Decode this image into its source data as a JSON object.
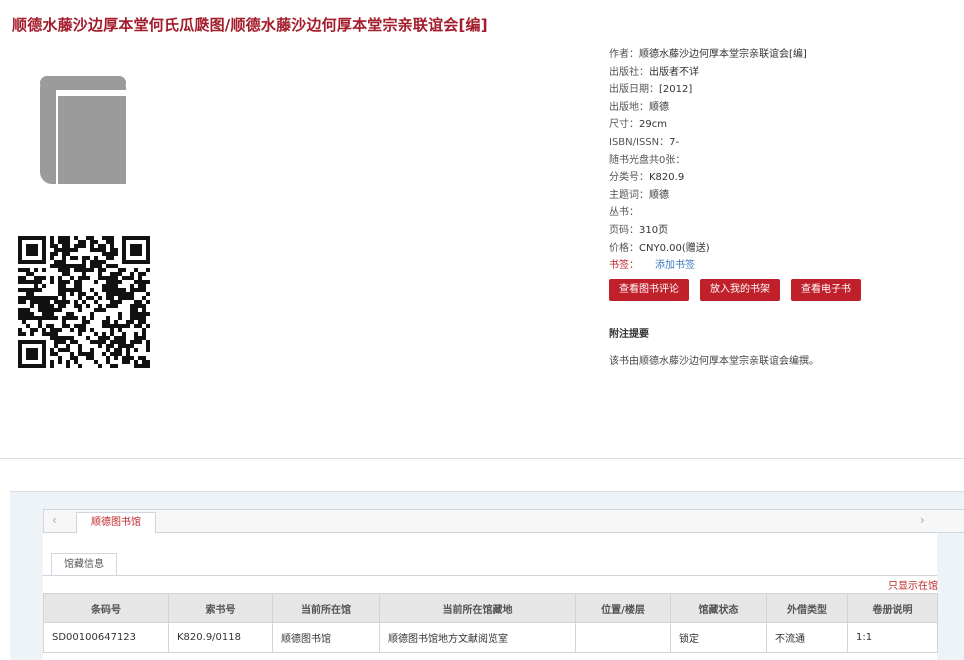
{
  "book": {
    "title": "顺德水藤沙边厚本堂何氏瓜瓞图/顺德水藤沙边何厚本堂宗亲联谊会[编]"
  },
  "metadata": [
    {
      "key": "作者：",
      "value": "顺德水藤沙边何厚本堂宗亲联谊会[编]"
    },
    {
      "key": "出版社：",
      "value": "出版者不详"
    },
    {
      "key": "出版日期：",
      "value": "[2012]"
    },
    {
      "key": "出版地：",
      "value": "顺德"
    },
    {
      "key": "尺寸：",
      "value": "29cm"
    },
    {
      "key": "ISBN/ISSN：",
      "value": "7-"
    },
    {
      "key": "随书光盘共0张：",
      "value": ""
    },
    {
      "key": "分类号：",
      "value": "K820.9"
    },
    {
      "key": "主题词：",
      "value": "顺德"
    },
    {
      "key": "丛书：",
      "value": ""
    },
    {
      "key": "页码：",
      "value": "310页"
    },
    {
      "key": "价格：",
      "value": "CNY0.00(赠送)"
    }
  ],
  "bookmark": {
    "key": "书签：",
    "action": "添加书签"
  },
  "actions": {
    "review": "查看图书评论",
    "shelf": "放入我的书架",
    "ebook": "查看电子书"
  },
  "note": {
    "heading": "附注提要",
    "text": "该书由顺德水藤沙边何厚本堂宗亲联谊会编撰。"
  },
  "holdings": {
    "library_tab": "顺德图书馆",
    "info_tab": "馆藏信息",
    "only_link": "只显示在馆",
    "columns": [
      "条码号",
      "索书号",
      "当前所在馆",
      "当前所在馆藏地",
      "位置/楼层",
      "馆藏状态",
      "外借类型",
      "卷册说明"
    ],
    "rows": [
      [
        "SD00100647123",
        "K820.9/0118",
        "顺德图书馆",
        "顺德图书馆地方文献阅览室",
        "",
        "锁定",
        "不流通",
        "1:1"
      ]
    ]
  },
  "colors": {
    "accent": "#c0202a",
    "title": "#a31c2b",
    "link": "#3a7bbf"
  },
  "icons": {
    "cover": "book-cover-icon",
    "qr": "qr-code-icon",
    "prev": "chevron-left-icon",
    "next": "chevron-right-icon"
  }
}
